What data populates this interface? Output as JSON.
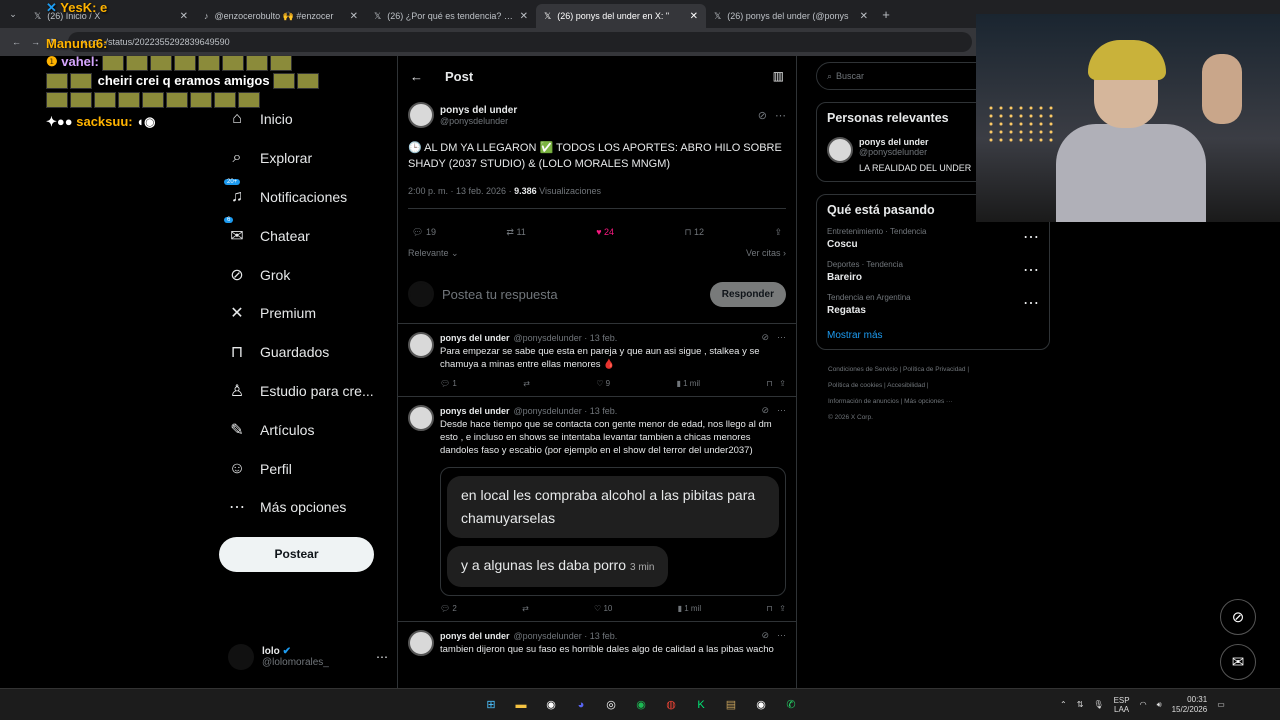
{
  "tabs": [
    {
      "label": "(26) Inicio / X",
      "icon": "x-logo-icon"
    },
    {
      "label": "@enzocerobulto 🙌 #enzocer",
      "icon": "tiktok-icon"
    },
    {
      "label": "(26) ¿Por qué es tendencia? en",
      "icon": "x-logo-icon"
    },
    {
      "label": "(26) ponys del under en X: \"",
      "icon": "x-logo-icon"
    },
    {
      "label": "(26) ponys del under (@ponys",
      "icon": "x-logo-icon"
    }
  ],
  "address": {
    "url": "x.co.../status/2022355292839649590"
  },
  "overlay": {
    "line1": "Manunu6:",
    "line0": "YesK: e",
    "user2": "vahel:",
    "msg2": "cheiri crei q eramos amigos",
    "user3": "sacksuu:"
  },
  "nav": [
    {
      "label": "Inicio",
      "icon": "home-icon",
      "glyph": "⌂"
    },
    {
      "label": "Explorar",
      "icon": "search-icon",
      "glyph": "⌕"
    },
    {
      "label": "Notificaciones",
      "icon": "bell-icon",
      "glyph": "🔔",
      "badge": "20+"
    },
    {
      "label": "Chatear",
      "icon": "mail-icon",
      "glyph": "✉",
      "badge": "6"
    },
    {
      "label": "Grok",
      "icon": "grok-icon",
      "glyph": "⊘"
    },
    {
      "label": "Premium",
      "icon": "x-logo-icon",
      "glyph": "✕"
    },
    {
      "label": "Guardados",
      "icon": "bookmark-icon",
      "glyph": "🔖"
    },
    {
      "label": "Estudio para cre...",
      "icon": "studio-icon",
      "glyph": "♙"
    },
    {
      "label": "Artículos",
      "icon": "article-icon",
      "glyph": "✎"
    },
    {
      "label": "Perfil",
      "icon": "profile-icon",
      "glyph": "☺"
    },
    {
      "label": "Más opciones",
      "icon": "more-icon",
      "glyph": "⋯"
    }
  ],
  "post_button": "Postear",
  "account": {
    "name": "lolo",
    "handle": "@lolomorales_"
  },
  "header": {
    "title": "Post"
  },
  "main_post": {
    "name": "ponys del under",
    "handle": "@ponysdelunder",
    "text": "🕒 AL DM YA LLEGARON ✅ TODOS LOS APORTES: ABRO HILO SOBRE SHADY (2037 STUDIO) & (LOLO MORALES MNGM)",
    "time": "2:00 p. m. · 13 feb. 2026 ·",
    "views": "9.386",
    "views_label": "Visualizaciones",
    "replies": "19",
    "reposts": "11",
    "likes": "24",
    "bookmarks": "12",
    "relevance": "Relevante",
    "quotes": "Ver citas"
  },
  "reply_box": {
    "placeholder": "Postea tu respuesta",
    "button": "Responder"
  },
  "thread": [
    {
      "name": "ponys del under",
      "handle": "@ponysdelunder · 13 feb.",
      "text": "Para empezar se sabe que esta en pareja y que aun asi sigue , stalkea y se chamuya a minas entre ellas menores 🩸",
      "replies": "1",
      "reposts": "",
      "likes": "9",
      "views": "1 mil"
    },
    {
      "name": "ponys del under",
      "handle": "@ponysdelunder · 13 feb.",
      "text": "Desde hace tiempo que se contacta con gente menor de edad, nos llego al dm esto , e incluso en shows se intentaba levantar tambien a chicas menores dandoles faso y escabio (por ejemplo en el show del terror del under2037)",
      "bubble1": "en local les compraba alcohol a las pibitas para chamuyarselas",
      "bubble2": "y a algunas les daba porro",
      "bubble_time": "3 min",
      "replies": "2",
      "reposts": "",
      "likes": "10",
      "views": "1 mil"
    },
    {
      "name": "ponys del under",
      "handle": "@ponysdelunder · 13 feb.",
      "text": "tambien dijeron que su faso es horrible dales algo de calidad a las pibas wacho"
    }
  ],
  "search": {
    "placeholder": "Buscar"
  },
  "relevant": {
    "title": "Personas relevantes",
    "name": "ponys del under",
    "handle": "@ponysdelunder",
    "bio": "LA REALIDAD DEL UNDER"
  },
  "trends": {
    "title": "Qué está pasando",
    "items": [
      {
        "category": "Entretenimiento · Tendencia",
        "name": "Coscu"
      },
      {
        "category": "Deportes · Tendencia",
        "name": "Bareiro"
      },
      {
        "category": "Tendencia en Argentina",
        "name": "Regatas"
      }
    ],
    "more": "Mostrar más"
  },
  "footer": {
    "l1": "Condiciones de Servicio | Política de Privacidad |",
    "l2": "Política de cookies | Accesibilidad |",
    "l3": "Información de anuncios | Más opciones ···",
    "l4": "© 2026 X Corp."
  },
  "taskbar": {
    "lang1": "ESP",
    "lang2": "LAA",
    "time": "00:31",
    "date": "15/2/2026"
  },
  "colors": {
    "accent": "#1d9bf0",
    "like": "#f91880"
  }
}
